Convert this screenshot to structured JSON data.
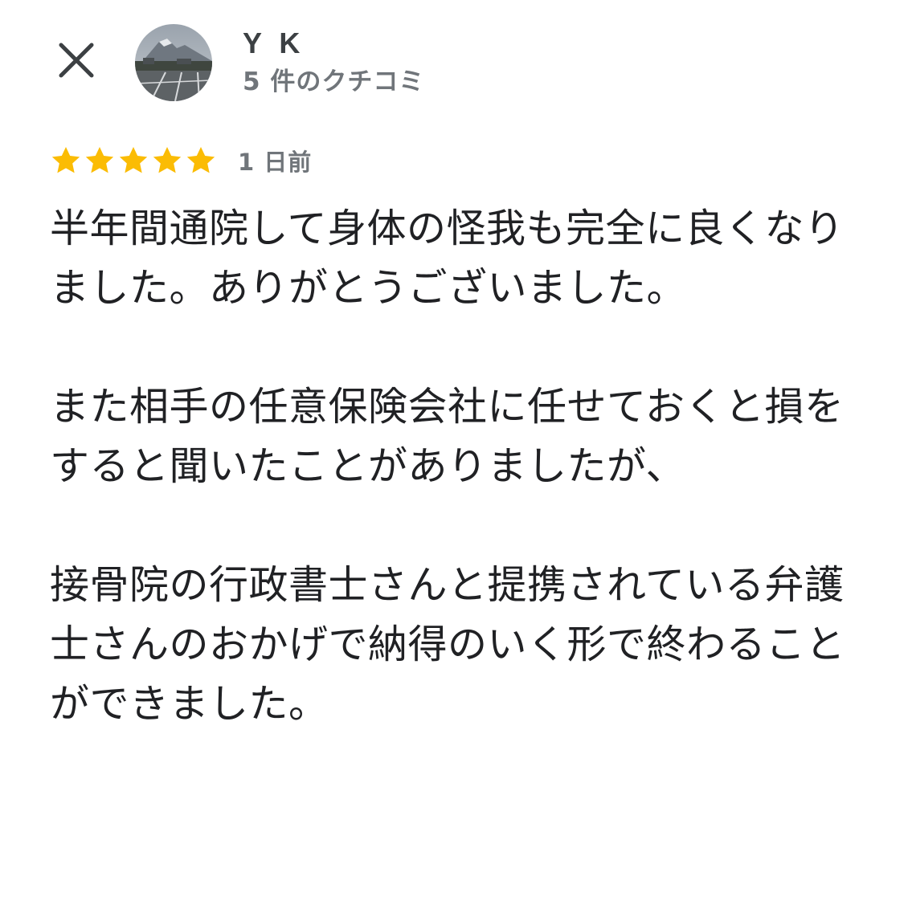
{
  "header": {
    "close_icon": "close-icon",
    "avatar_icon": "avatar-photo",
    "reviewer_name": "Y K",
    "review_count": "5 件のクチコミ"
  },
  "review": {
    "rating": 5,
    "rating_max": 5,
    "star_color": "#fbbc04",
    "date": "1 日前",
    "paragraphs": [
      "半年間通院して身体の怪我も完全に良くなりました。ありがとうございました。",
      "また相手の任意保険会社に任せておくと損をすると聞いたことがありましたが、",
      "接骨院の行政書士さんと提携されている弁護士さんのおかげで納得のいく形で終わることができました。"
    ]
  }
}
